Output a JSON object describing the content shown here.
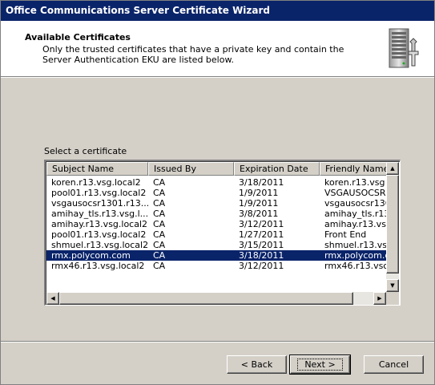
{
  "window": {
    "title": "Office Communications Server Certificate Wizard"
  },
  "header": {
    "title": "Available Certificates",
    "description": "Only the trusted certificates that have a private key and contain the Server Authentication EKU are listed below.",
    "icon": "server-tools-icon"
  },
  "main": {
    "select_label": "Select a certificate",
    "columns": [
      "Subject Name",
      "Issued By",
      "Expiration Date",
      "Friendly Name"
    ],
    "rows": [
      {
        "subject": "koren.r13.vsg.local2",
        "issuer": "CA",
        "expiration": "3/18/2011",
        "friendly": "koren.r13.vsg"
      },
      {
        "subject": "pool01.r13.vsg.local2",
        "issuer": "CA",
        "expiration": "1/9/2011",
        "friendly": "VSGAUSOCSR"
      },
      {
        "subject": "vsgausocsr1301.r13...",
        "issuer": "CA",
        "expiration": "1/9/2011",
        "friendly": "vsgausocsr130"
      },
      {
        "subject": "amihay_tls.r13.vsg.l...",
        "issuer": "CA",
        "expiration": "3/8/2011",
        "friendly": "amihay_tls.r13"
      },
      {
        "subject": "amihay.r13.vsg.local2",
        "issuer": "CA",
        "expiration": "3/12/2011",
        "friendly": "amihay.r13.vs"
      },
      {
        "subject": "pool01.r13.vsg.local2",
        "issuer": "CA",
        "expiration": "1/27/2011",
        "friendly": "Front End"
      },
      {
        "subject": "shmuel.r13.vsg.local2",
        "issuer": "CA",
        "expiration": "3/15/2011",
        "friendly": "shmuel.r13.vs"
      },
      {
        "subject": "rmx.polycom.com",
        "issuer": "CA",
        "expiration": "3/18/2011",
        "friendly": "rmx.polycom.c"
      },
      {
        "subject": "rmx46.r13.vsg.local2",
        "issuer": "CA",
        "expiration": "3/12/2011",
        "friendly": "rmx46.r13.vsc"
      }
    ],
    "selected_row": 7
  },
  "footer": {
    "back_label": "< Back",
    "next_label": "Next >",
    "cancel_label": "Cancel"
  },
  "colors": {
    "titlebar": "#0a246a",
    "selection": "#0a246a",
    "face": "#d4d0c8"
  }
}
